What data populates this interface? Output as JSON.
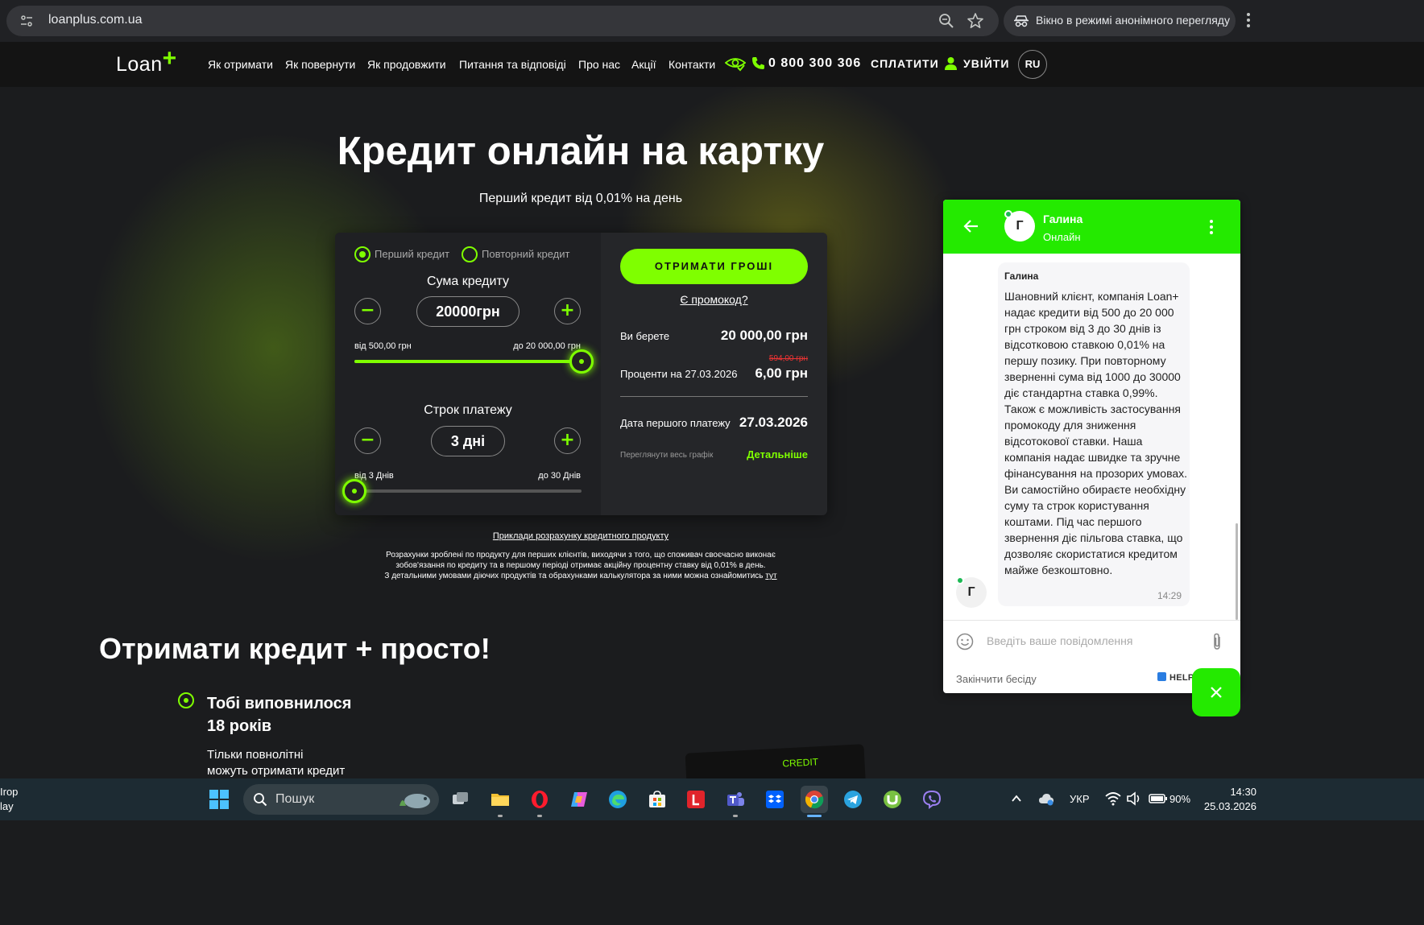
{
  "browser": {
    "url": "loanplus.com.ua",
    "incognito_label": "Вікно в режимі анонімного перегляду"
  },
  "nav": {
    "logo_text": "Loan",
    "logo_plus": "+",
    "links": [
      "Як отримати",
      "Як повернути",
      "Як продовжити",
      "Питання та відповіді",
      "Про нас",
      "Акції",
      "Контакти"
    ],
    "phone": "0 800 300 306",
    "pay": "СПЛАТИТИ",
    "login": "УВІЙТИ",
    "lang": "RU"
  },
  "hero": {
    "title": "Кредит онлайн на картку",
    "subtitle": "Перший кредит від 0,01% на день"
  },
  "calculator": {
    "radio_first": "Перший кредит",
    "radio_repeat": "Повторний кредит",
    "selected_radio": "first",
    "amount": {
      "heading": "Сума кредиту",
      "value": "20000грн",
      "min_label": "від 500,00 грн",
      "max_label": "до 20 000,00 грн",
      "min": 500,
      "max": 20000,
      "current": 20000
    },
    "term": {
      "heading": "Строк платежу",
      "value": "3 дні",
      "min_label": "від 3 Днів",
      "max_label": "до 30 Днів",
      "min": 3,
      "max": 30,
      "current": 3
    },
    "minus_symbol": "−",
    "plus_symbol": "+",
    "cta": "ОТРИМАТИ ГРОШІ",
    "promo": "Є промокод?",
    "take_label": "Ви берете",
    "take_value": "20 000,00 грн",
    "interest_label": "Проценти на 27.03.2026",
    "interest_old": "594,00 грн",
    "interest_value": "6,00 грн",
    "payment_label": "Дата першого платежу",
    "payment_value": "27.03.2026",
    "schedule": "Переглянути весь графік",
    "more": "Детальніше"
  },
  "disclaimer": {
    "examples_link": "Приклади розрахунку кредитного продукту",
    "line1": "Розрахунки зроблені по продукту для перших клієнтів, виходячи з того, що споживач своєчасно виконає",
    "line2": "зобов'язання по кредиту та в першому періоді отримає акційну процентну ставку від 0,01% в день.",
    "line3": "З детальними умовами діючих продуктів та обрахунками калькулятора за ними можна ознайомитись",
    "link": "тут"
  },
  "section": {
    "title": "Отримати кредит + просто!",
    "bullet_title_1": "Тобі виповнилося",
    "bullet_title_2": "18 років",
    "bullet_text_1": "Тільки повнолітні",
    "bullet_text_2": "можуть отримати кредит",
    "card_text": "CREDIT"
  },
  "chat": {
    "agent_name": "Галина",
    "agent_initial": "Г",
    "status": "Онлайн",
    "message_author": "Галина",
    "message": "Шановний клієнт, компанія Loan+ надає кредити від 500 до 20 000 грн строком від 3 до 30 днів із відсотковою ставкою 0,01% на першу позику. При повторному зверненні  сума  від 1000 до 30000 діє стандартна  ставка 0,99%.  Також є можливість застосування промокоду для зниження відсотокової ставки. Наша компанія надає швидке та зручне фінансування на прозорих умовах. Ви самостійно обираєте необхідну суму та строк користування коштами. Під час першого звернення діє пільгова ставка, що дозволяє скористатися кредитом майже безкоштовно.",
    "time": "14:29",
    "input_placeholder": "Введіть ваше повідомлення",
    "end_chat": "Закінчити бесіду",
    "brand": "HELPCRUNCH"
  },
  "taskbar": {
    "left_line1": "Irop",
    "left_line2": "lay",
    "search_text": "Пошук",
    "lang": "УКР",
    "battery": "90%",
    "time": "14:30",
    "date": "25.03.2026"
  },
  "colors": {
    "accent": "#7fff00",
    "chat_green": "#24ea00",
    "page_bg": "#1b1c1e"
  }
}
